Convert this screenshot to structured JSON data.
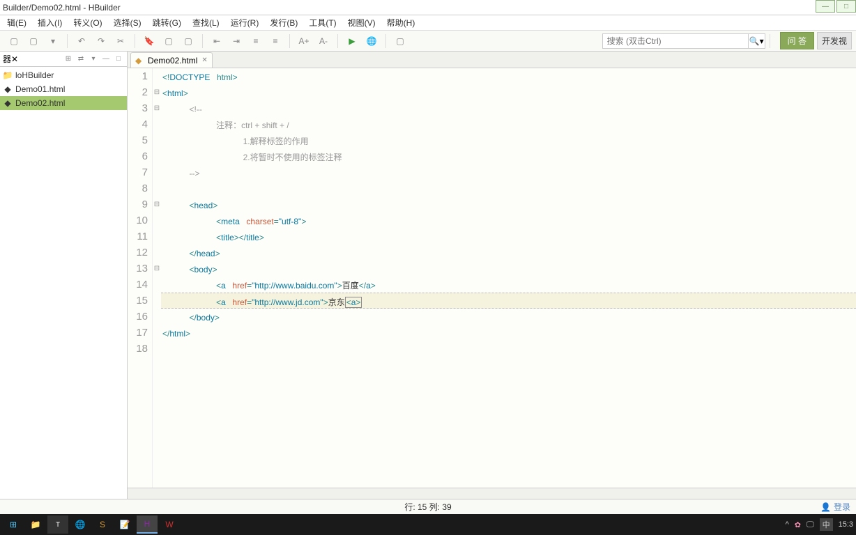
{
  "window": {
    "title": "Builder/Demo02.html - HBuilder"
  },
  "menu": {
    "items": [
      "辑(E)",
      "插入(I)",
      "转义(O)",
      "选择(S)",
      "跳转(G)",
      "查找(L)",
      "运行(R)",
      "发行(B)",
      "工具(T)",
      "视图(V)",
      "帮助(H)"
    ]
  },
  "toolbar": {
    "search_placeholder": "搜索 (双击Ctrl)",
    "qa_label": "问 答",
    "dev_label": "开发视"
  },
  "sidebar": {
    "header": "器",
    "items": [
      "loHBuilder",
      "Demo01.html",
      "Demo02.html"
    ],
    "selected_index": 2
  },
  "tabs": {
    "items": [
      {
        "label": "Demo02.html"
      }
    ]
  },
  "code_lines": [
    {
      "num": "1",
      "fold": "",
      "html": "<span class='tag'>&lt;!</span><span class='kw'>DOCTYPE</span> <span class='tag'>html&gt;</span>"
    },
    {
      "num": "2",
      "fold": "⊟",
      "html": "<span class='tag'>&lt;</span><span class='kw'>html</span><span class='tag'>&gt;</span>"
    },
    {
      "num": "3",
      "fold": "⊟",
      "html": "    <span class='cmt'>&lt;!--</span>"
    },
    {
      "num": "4",
      "fold": "",
      "html": "        <span class='cmt'>注释：ctrl + shift + /</span>"
    },
    {
      "num": "5",
      "fold": "",
      "html": "            <span class='cmt'>1.解释标签的作用</span>"
    },
    {
      "num": "6",
      "fold": "",
      "html": "            <span class='cmt'>2.将暂时不使用的标签注释</span>"
    },
    {
      "num": "7",
      "fold": "",
      "html": "    <span class='cmt'>--&gt;</span>"
    },
    {
      "num": "8",
      "fold": "",
      "html": ""
    },
    {
      "num": "9",
      "fold": "⊟",
      "html": "    <span class='tag'>&lt;</span><span class='kw'>head</span><span class='tag'>&gt;</span>"
    },
    {
      "num": "10",
      "fold": "",
      "html": "        <span class='tag'>&lt;</span><span class='kw'>meta</span> <span class='attr'>charset</span><span class='tag'>=</span><span class='str'>\"utf-8\"</span><span class='tag'>&gt;</span>"
    },
    {
      "num": "11",
      "fold": "",
      "html": "        <span class='tag'>&lt;</span><span class='kw'>title</span><span class='tag'>&gt;&lt;/</span><span class='kw'>title</span><span class='tag'>&gt;</span>"
    },
    {
      "num": "12",
      "fold": "",
      "html": "    <span class='tag'>&lt;/</span><span class='kw'>head</span><span class='tag'>&gt;</span>"
    },
    {
      "num": "13",
      "fold": "⊟",
      "html": "    <span class='tag'>&lt;</span><span class='kw'>body</span><span class='tag'>&gt;</span>"
    },
    {
      "num": "14",
      "fold": "",
      "html": "        <span class='tag'>&lt;</span><span class='kw'>a</span> <span class='attr'>href</span><span class='tag'>=</span><span class='str'>\"http://www.baidu.com\"</span><span class='tag'>&gt;</span><span class='txt'>百度</span><span class='tag'>&lt;/</span><span class='kw'>a</span><span class='tag'>&gt;</span>"
    },
    {
      "num": "15",
      "fold": "",
      "hl": true,
      "html": "        <span class='tag'>&lt;</span><span class='kw'>a</span> <span class='attr'>href</span><span class='tag'>=</span><span class='str'>\"http://www.jd.com\"</span><span class='tag'>&gt;</span><span class='txt'>京东</span><span class='cursor-box'><span class='tag'>&lt;</span><span class='kw'>a</span><span class='tag'>&gt;</span></span>"
    },
    {
      "num": "16",
      "fold": "",
      "html": "    <span class='tag'>&lt;/</span><span class='kw'>body</span><span class='tag'>&gt;</span>"
    },
    {
      "num": "17",
      "fold": "",
      "html": "<span class='tag'>&lt;/</span><span class='kw'>html</span><span class='tag'>&gt;</span>"
    },
    {
      "num": "18",
      "fold": "",
      "html": ""
    }
  ],
  "status": {
    "position": "行: 15 列: 39",
    "login": "登录"
  },
  "taskbar": {
    "time": "15:3",
    "ime": "中"
  }
}
